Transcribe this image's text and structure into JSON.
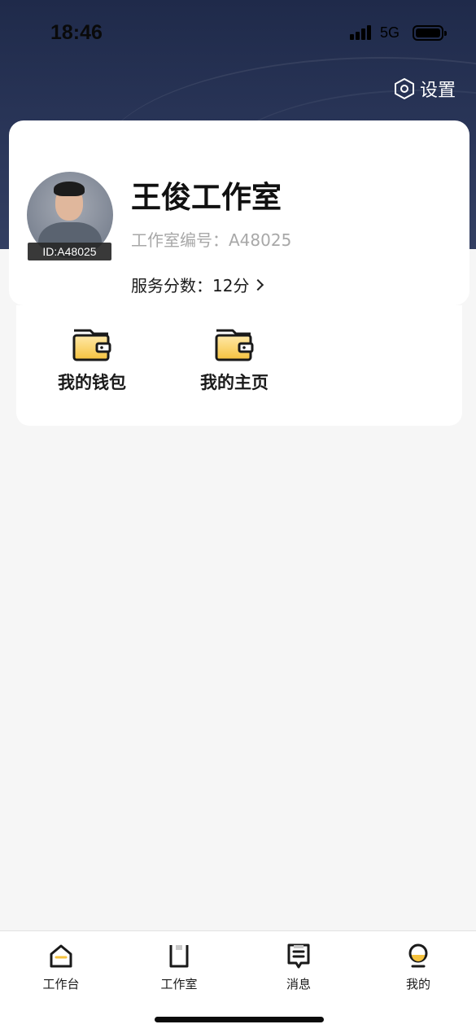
{
  "status_bar": {
    "time": "18:46",
    "network": "5G"
  },
  "header": {
    "settings_label": "设置"
  },
  "profile": {
    "avatar_id": "ID:A48025",
    "studio_name": "王俊工作室",
    "studio_number": "工作室编号：A48025",
    "service_score": "服务分数：12分"
  },
  "quick_actions": [
    {
      "label": "我的钱包",
      "icon": "wallet-icon"
    },
    {
      "label": "我的主页",
      "icon": "wallet-icon"
    }
  ],
  "tabbar": {
    "items": [
      {
        "label": "工作台",
        "icon": "home-icon"
      },
      {
        "label": "工作室",
        "icon": "studio-icon"
      },
      {
        "label": "消息",
        "icon": "message-icon"
      },
      {
        "label": "我的",
        "icon": "profile-icon",
        "active": true
      }
    ]
  },
  "colors": {
    "header_bg": "#2b375a",
    "accent_yellow": "#f7c948",
    "page_bg": "#f6f6f6"
  }
}
